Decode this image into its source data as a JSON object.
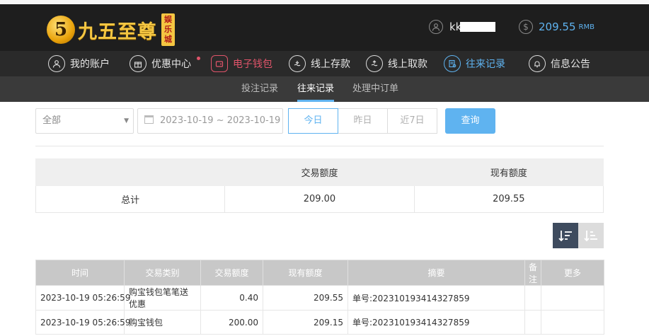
{
  "header": {
    "logo_mark": "5",
    "logo_text": "九五至尊",
    "logo_badge": "娱乐城",
    "username": "kk",
    "balance": "209.55",
    "balance_unit": "RMB"
  },
  "nav": {
    "items": [
      {
        "label": "我的账户",
        "icon": "user-icon"
      },
      {
        "label": "优惠中心",
        "icon": "gift-icon"
      },
      {
        "label": "电子钱包",
        "icon": "wallet-icon"
      },
      {
        "label": "线上存款",
        "icon": "deposit-icon"
      },
      {
        "label": "线上取款",
        "icon": "withdraw-icon"
      },
      {
        "label": "往来记录",
        "icon": "records-icon"
      },
      {
        "label": "信息公告",
        "icon": "bell-icon"
      }
    ],
    "active": "往来记录"
  },
  "subnav": {
    "tabs": [
      "投注记录",
      "往来记录",
      "处理中订单"
    ],
    "active": "往来记录"
  },
  "filters": {
    "type_select": "全部",
    "date_range": "2023-10-19 ~ 2023-10-19",
    "quick_buttons": [
      "今日",
      "昨日",
      "近7日"
    ],
    "active_quick": "今日",
    "search_label": "查询"
  },
  "summary": {
    "headers": [
      "",
      "交易额度",
      "现有额度"
    ],
    "row": [
      "总计",
      "209.00",
      "209.55"
    ]
  },
  "records": {
    "columns": [
      "时间",
      "交易类别",
      "交易额度",
      "现有额度",
      "摘要",
      "备注",
      "更多"
    ],
    "rows": [
      [
        "2023-10-19 05:26:59",
        "购宝钱包笔笔送优惠",
        "0.40",
        "209.55",
        "单号:20231019341432​7859",
        "",
        ""
      ],
      [
        "2023-10-19 05:26:59",
        "购宝钱包",
        "200.00",
        "209.15",
        "单号:202310193414327859",
        "",
        ""
      ]
    ]
  },
  "colors": {
    "accent": "#5fb3f0",
    "wallet": "#e0546a",
    "header_bg": "#1e1e1e",
    "nav_bg": "#2a2a2a",
    "subnav_bg": "#3a3a3a",
    "gold": "#f4c642"
  }
}
